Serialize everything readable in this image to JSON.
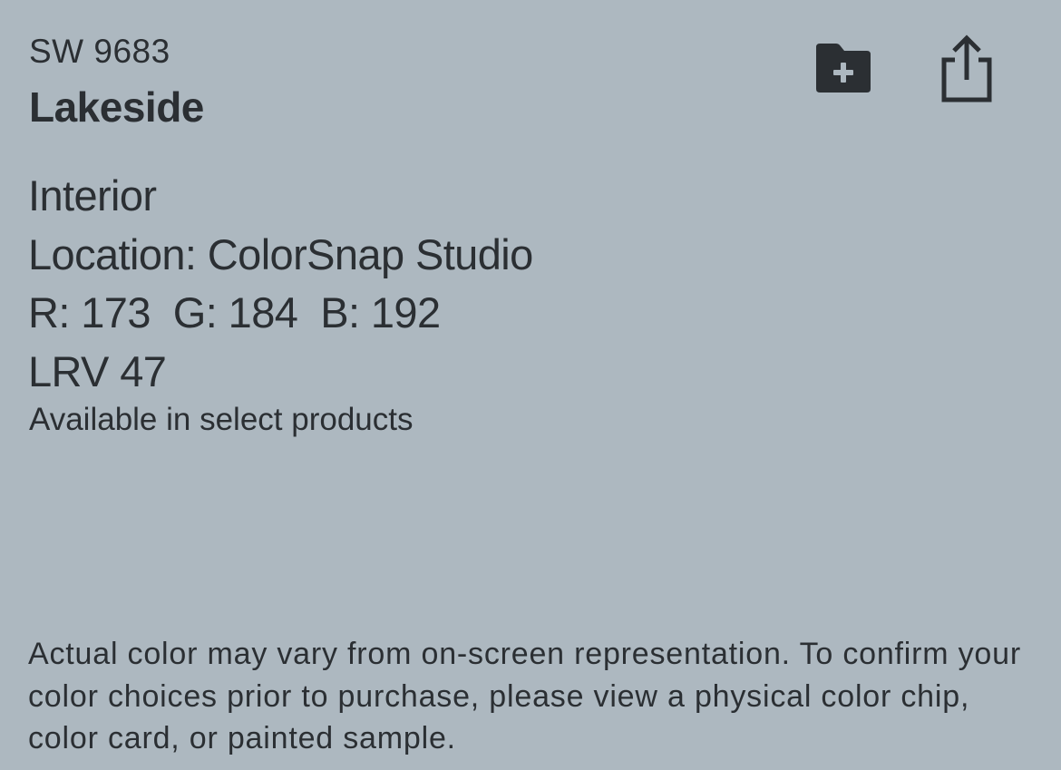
{
  "color": {
    "code": "SW 9683",
    "name": "Lakeside",
    "swatch_hex": "#ADB8C0"
  },
  "details": {
    "usage": "Interior",
    "location": "Location: ColorSnap Studio",
    "rgb": "R: 173  G: 184  B: 192",
    "lrv": "LRV 47",
    "availability": "Available in select products"
  },
  "toolbar": {
    "add_to_folder_icon": "folder-plus-icon",
    "share_icon": "share-icon"
  },
  "disclaimer": "Actual color may vary from on-screen representation. To confirm your color choices prior to purchase, please view a physical color chip, color card, or painted sample."
}
